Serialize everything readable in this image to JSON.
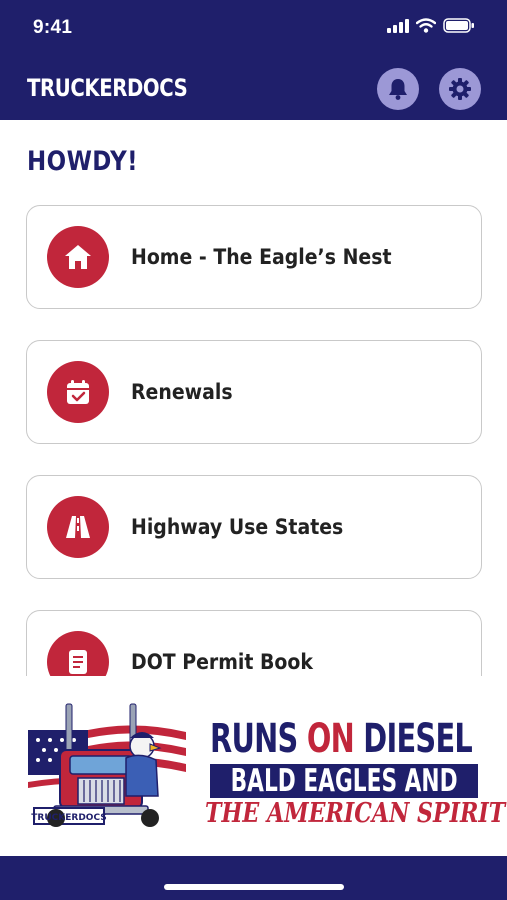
{
  "status_bar": {
    "time": "9:41",
    "icons": [
      "signal-icon",
      "wifi-icon",
      "battery-icon"
    ]
  },
  "header": {
    "title": "TRUCKERDOCS",
    "actions": [
      "bell-icon",
      "gear-icon"
    ]
  },
  "greeting": "HOWDY!",
  "menu": {
    "items": [
      {
        "label": "Home - The Eagle’s Nest",
        "icon": "home-icon"
      },
      {
        "label": "Renewals",
        "icon": "calendar-check-icon"
      },
      {
        "label": "Highway Use States",
        "icon": "road-icon"
      },
      {
        "label": "DOT Permit Book",
        "icon": "document-icon"
      }
    ]
  },
  "banner": {
    "line1_a": "RUNS ",
    "line1_b": "ON",
    "line1_c": " DIESEL",
    "line2": "BALD EAGLES AND",
    "line3": "THE AMERICAN SPIRIT",
    "logo_text": "TRUCKERDOCS"
  },
  "colors": {
    "navy": "#1f1f6b",
    "accent": "#c1263b",
    "button": "#9c98d6"
  }
}
